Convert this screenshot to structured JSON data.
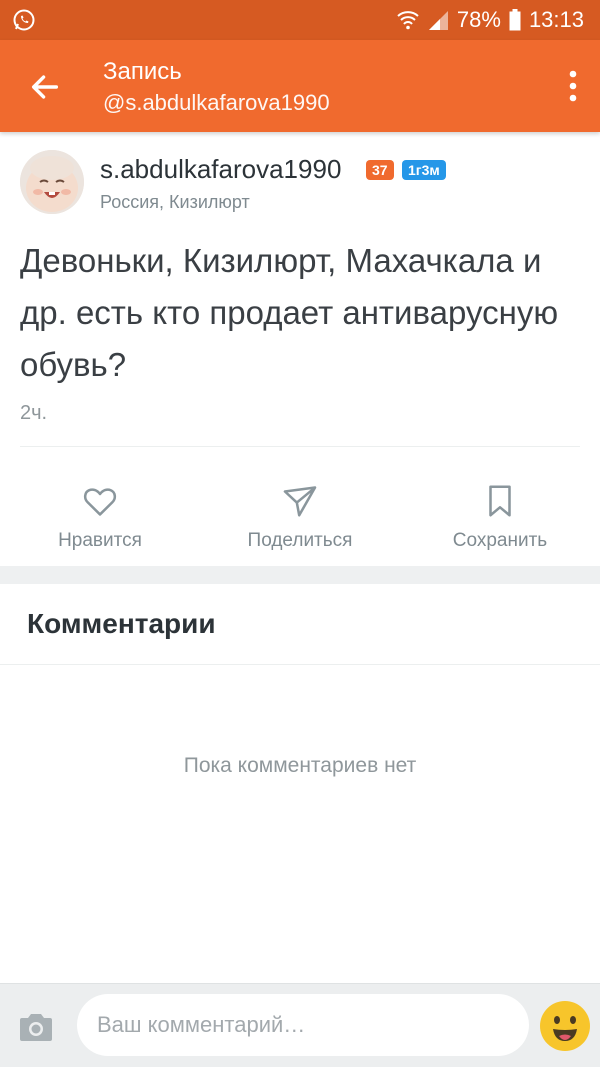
{
  "status_bar": {
    "battery": "78%",
    "time": "13:13",
    "icons": [
      "whatsapp-icon",
      "wifi-icon",
      "signal-icon",
      "battery-icon"
    ]
  },
  "app_bar": {
    "title": "Запись",
    "subtitle": "@s.abdulkafarova1990",
    "color": "#f06a2e"
  },
  "post": {
    "author": "s.abdulkafarova1990",
    "level_badge": "37",
    "age_badge": "1г3м",
    "location": "Россия, Кизилюрт",
    "text": "Девоньки, Кизилюрт, Махачкала и др. есть кто продает антиварусную обувь?",
    "time": "2ч."
  },
  "actions": {
    "like": "Нравится",
    "share": "Поделиться",
    "save": "Сохранить"
  },
  "comments": {
    "title": "Комментарии",
    "empty_text": "Пока комментариев нет"
  },
  "composer": {
    "placeholder": "Ваш комментарий…"
  }
}
